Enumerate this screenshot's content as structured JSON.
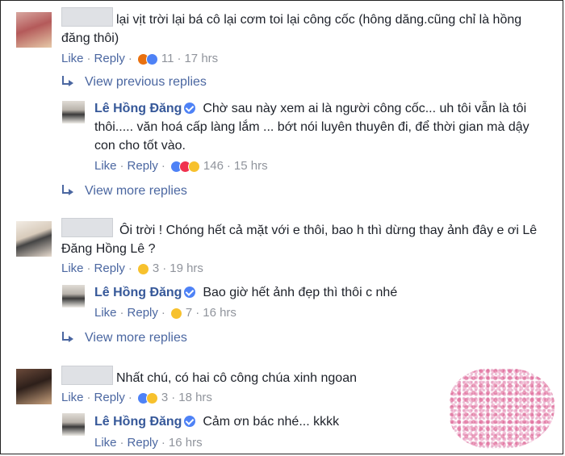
{
  "comments": [
    {
      "text": "lại vịt trời lại bá cô lại cơm toi lại công cốc (hông dăng.cũng chỉ là hồng đăng thôi)",
      "like": "Like",
      "reply": "Reply",
      "count": "11",
      "time": "17 hrs",
      "reactions": [
        "angry",
        "like"
      ],
      "view_replies": "View previous replies",
      "reply_item": {
        "author": "Lê Hồng Đăng",
        "text": "Chờ sau này xem ai là người công cốc... uh tôi vẫn là tôi thôi..... văn hoá cấp làng lắm ... bớt nói luyên thuyên đi, để thời gian mà dậy con cho tốt vào.",
        "like": "Like",
        "reply": "Reply",
        "count": "146",
        "time": "15 hrs",
        "reactions": [
          "like",
          "love",
          "haha"
        ]
      },
      "more_replies": "View more replies"
    },
    {
      "text": "Ôi trời ! Chóng hết cả mặt với e thôi, bao h thì dừng thay ảnh đây e ơi Lê Đăng Hồng Lê ?",
      "like": "Like",
      "reply": "Reply",
      "count": "3",
      "time": "19 hrs",
      "reactions": [
        "haha"
      ],
      "reply_item": {
        "author": "Lê Hồng Đăng",
        "text": "Bao giờ hết ảnh đẹp thì thôi c nhé",
        "like": "Like",
        "reply": "Reply",
        "count": "7",
        "time": "16 hrs",
        "reactions": [
          "haha"
        ]
      },
      "more_replies": "View more replies"
    },
    {
      "text": "Nhất chú, có hai cô công chúa xinh ngoan",
      "like": "Like",
      "reply": "Reply",
      "count": "3",
      "time": "18 hrs",
      "reactions": [
        "like",
        "haha"
      ],
      "reply_item": {
        "author": "Lê Hồng Đăng",
        "text": "Cảm ơn bác nhé... kkkk",
        "like": "Like",
        "reply": "Reply",
        "time": "16 hrs"
      }
    }
  ],
  "colors": {
    "link": "#4b67a1",
    "name": "#365899",
    "meta": "#90949c",
    "like_reaction": "#4e82f6",
    "love_reaction": "#f0324e",
    "haha_reaction": "#f7c12d",
    "angry_reaction": "#e9710f"
  }
}
